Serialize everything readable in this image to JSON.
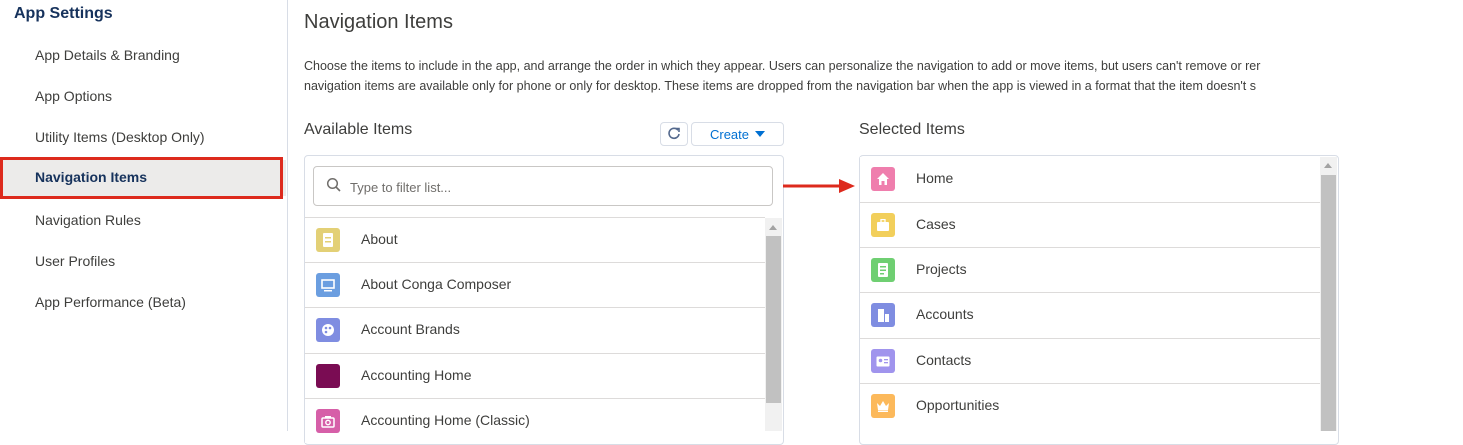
{
  "sidebar": {
    "title": "App Settings",
    "items": [
      {
        "label": "App Details & Branding"
      },
      {
        "label": "App Options"
      },
      {
        "label": "Utility Items (Desktop Only)"
      },
      {
        "label": "Navigation Items",
        "active": true
      },
      {
        "label": "Navigation Rules"
      },
      {
        "label": "User Profiles"
      },
      {
        "label": "App Performance (Beta)"
      }
    ]
  },
  "main": {
    "title": "Navigation Items",
    "description": [
      "Choose the items to include in the app, and arrange the order in which they appear. Users can personalize the navigation to add or move items, but users can't remove or rer",
      "navigation items are available only for phone or only for desktop. These items are dropped from the navigation bar when the app is viewed in a format that the item doesn't s"
    ],
    "available": {
      "label": "Available Items",
      "create_label": "Create",
      "filter_placeholder": "Type to filter list...",
      "items": [
        {
          "label": "About",
          "icon": "document-icon",
          "color": "#e3d076"
        },
        {
          "label": "About Conga Composer",
          "icon": "monitor-icon",
          "color": "#6b9ee0"
        },
        {
          "label": "Account Brands",
          "icon": "palette-icon",
          "color": "#7f8de1"
        },
        {
          "label": "Accounting Home",
          "icon": "blank-icon",
          "color": "#7a0c53"
        },
        {
          "label": "Accounting Home (Classic)",
          "icon": "camera-icon",
          "color": "#d65fa8"
        }
      ]
    },
    "selected": {
      "label": "Selected Items",
      "items": [
        {
          "label": "Home",
          "icon": "home-icon",
          "color": "#ef7ead"
        },
        {
          "label": "Cases",
          "icon": "briefcase-icon",
          "color": "#f2cf5b"
        },
        {
          "label": "Projects",
          "icon": "project-icon",
          "color": "#6fcf72"
        },
        {
          "label": "Accounts",
          "icon": "building-icon",
          "color": "#7f8de1"
        },
        {
          "label": "Contacts",
          "icon": "contact-card-icon",
          "color": "#a094ed"
        },
        {
          "label": "Opportunities",
          "icon": "crown-icon",
          "color": "#fcb95b"
        }
      ]
    }
  },
  "colors": {
    "accent": "#0070d2",
    "highlight": "#dd2a1d"
  }
}
